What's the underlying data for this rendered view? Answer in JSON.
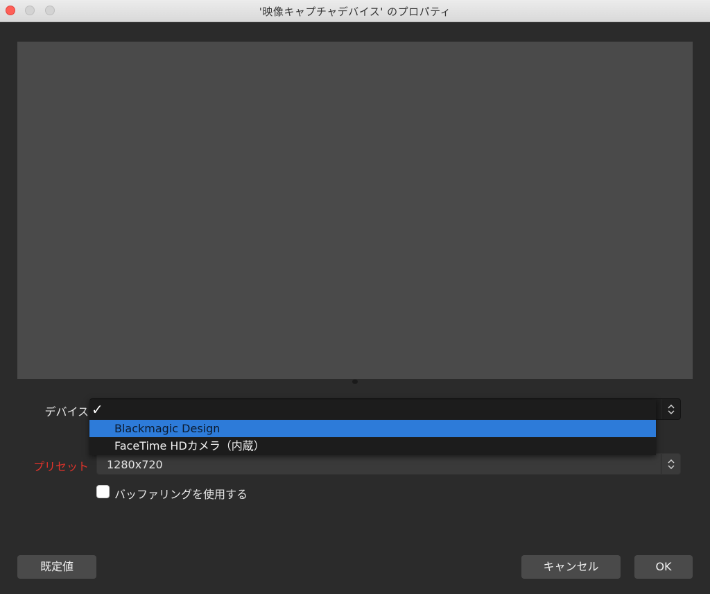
{
  "window": {
    "title": "'映像キャプチャデバイス' のプロパティ"
  },
  "form": {
    "device_label": "デバイス",
    "preset_label": "プリセット",
    "preset_value": "1280x720",
    "buffering_label": "バッファリングを使用する",
    "buffering_checked": false
  },
  "device_dropdown": {
    "check_glyph": "✓",
    "options": [
      {
        "label": "Blackmagic Design",
        "selected": true
      },
      {
        "label": "FaceTime HDカメラ（内蔵）",
        "selected": false
      }
    ]
  },
  "buttons": {
    "defaults": "既定値",
    "cancel": "キャンセル",
    "ok": "OK"
  },
  "colors": {
    "preset_label": "#e0332b",
    "highlight": "#2d7bd9",
    "close_button": "#fe5f57"
  }
}
